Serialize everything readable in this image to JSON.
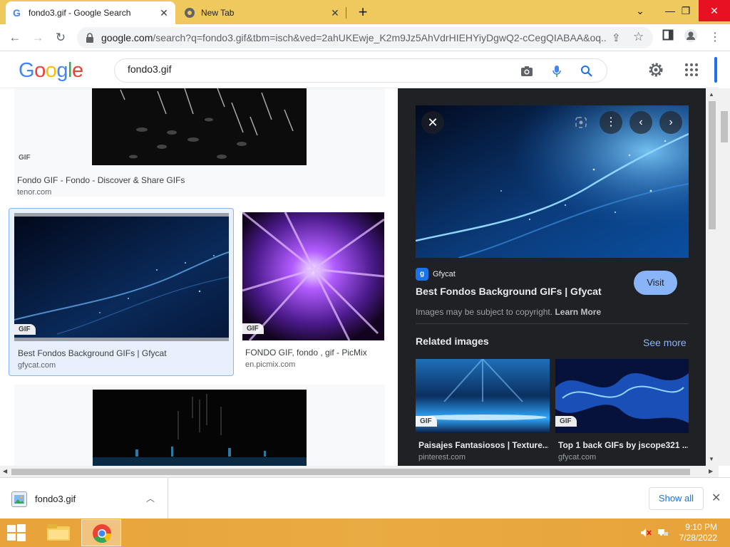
{
  "browser": {
    "tabs": [
      {
        "title": "fondo3.gif - Google Search",
        "active": true
      },
      {
        "title": "New Tab",
        "active": false
      }
    ],
    "url_main": "google.com",
    "url_rest": "/search?q=fondo3.gif&tbm=isch&ved=2ahUKEwje_K2m9Jz5AhVdrHIEHYiyDgwQ2-cCegQIABAA&oq..."
  },
  "google": {
    "logo_letters": [
      "G",
      "o",
      "o",
      "g",
      "l",
      "e"
    ],
    "query": "fondo3.gif"
  },
  "results": [
    {
      "title": "Fondo GIF - Fondo - Discover & Share GIFs",
      "source": "tenor.com",
      "badge": "GIF"
    },
    {
      "title": "Best Fondos Background GIFs | Gfycat",
      "source": "gfycat.com",
      "badge": "GIF"
    },
    {
      "title": "FONDO GIF, fondo , gif - PicMix",
      "source": "en.picmix.com",
      "badge": "GIF"
    }
  ],
  "preview": {
    "source_name": "Gfycat",
    "favicon_letter": "g",
    "title": "Best Fondos Background GIFs | Gfycat",
    "visit_label": "Visit",
    "copyright_text": "Images may be subject to copyright.",
    "learn_more": "Learn More",
    "related_title": "Related images",
    "see_more": "See more",
    "related": [
      {
        "title": "Paisajes Fantasiosos | Texture...",
        "source": "pinterest.com",
        "badge": "GIF"
      },
      {
        "title": "Top 1 back GIFs by jscope321 ...",
        "source": "gfycat.com",
        "badge": "GIF"
      }
    ]
  },
  "downloads": {
    "file_name": "fondo3.gif",
    "show_all": "Show all"
  },
  "taskbar": {
    "time": "9:10 PM",
    "date": "7/28/2022"
  },
  "colors": {
    "titlebar": "#f0c95e",
    "accent": "#1a73e8",
    "preview_bg": "#202124",
    "visit_button": "#8ab4f8"
  }
}
